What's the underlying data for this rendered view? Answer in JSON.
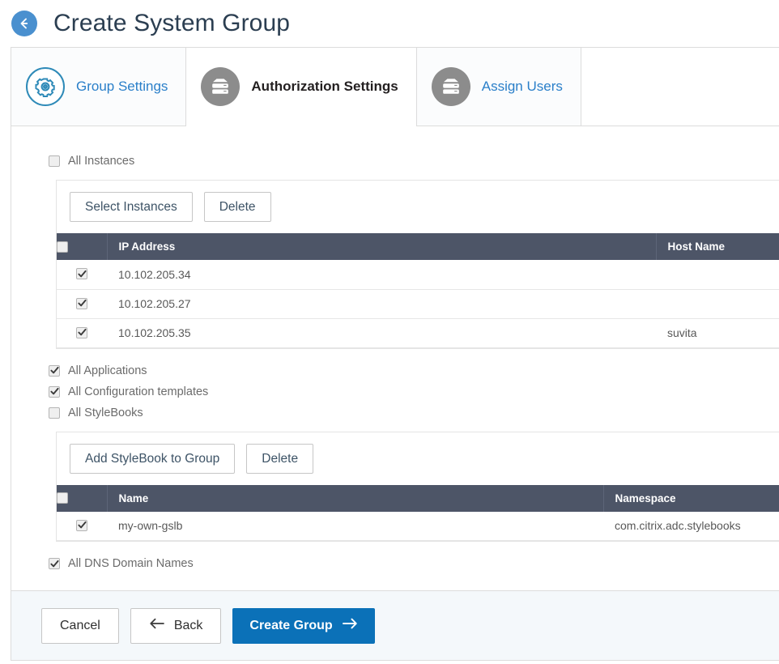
{
  "header": {
    "back_icon": "back-arrow-icon",
    "title": "Create System Group"
  },
  "tabs": [
    {
      "label": "Group Settings",
      "icon": "gear-icon",
      "active": false
    },
    {
      "label": "Authorization Settings",
      "icon": "stack-icon",
      "active": true
    },
    {
      "label": "Assign Users",
      "icon": "stack-icon",
      "active": false
    }
  ],
  "instances": {
    "all_label": "All Instances",
    "all_checked": false,
    "buttons": {
      "select": "Select Instances",
      "delete": "Delete"
    },
    "columns": [
      "",
      "IP Address",
      "Host Name"
    ],
    "header_checked": false,
    "rows": [
      {
        "checked": true,
        "ip": "10.102.205.34",
        "host": ""
      },
      {
        "checked": true,
        "ip": "10.102.205.27",
        "host": ""
      },
      {
        "checked": true,
        "ip": "10.102.205.35",
        "host": "suvita"
      }
    ]
  },
  "options": [
    {
      "label": "All Applications",
      "checked": true
    },
    {
      "label": "All Configuration templates",
      "checked": true
    },
    {
      "label": "All StyleBooks",
      "checked": false
    }
  ],
  "stylebooks": {
    "buttons": {
      "add": "Add StyleBook to Group",
      "delete": "Delete"
    },
    "columns": [
      "",
      "Name",
      "Namespace"
    ],
    "header_checked": false,
    "rows": [
      {
        "checked": true,
        "name": "my-own-gslb",
        "namespace": "com.citrix.adc.stylebooks"
      }
    ]
  },
  "dns": {
    "label": "All DNS Domain Names",
    "checked": true
  },
  "footer": {
    "cancel": "Cancel",
    "back": "Back",
    "create": "Create Group",
    "back_icon": "arrow-left-icon",
    "create_icon": "arrow-right-icon"
  },
  "colors": {
    "primary_blue": "#0b71b8",
    "link_blue": "#2a7fc9",
    "table_header": "#4d5567",
    "footer_bg": "#f4f8fb",
    "title_text": "#2b3e51"
  }
}
